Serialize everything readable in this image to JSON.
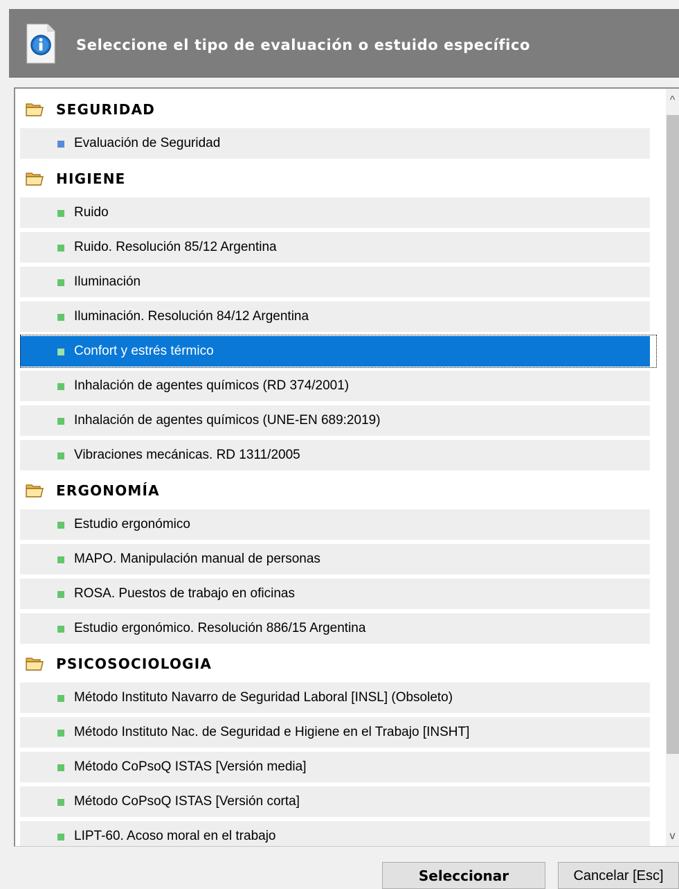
{
  "header": {
    "title": "Seleccione el tipo de evaluación o estuido específico",
    "icon": "info-icon"
  },
  "tree": [
    {
      "type": "group",
      "label": "SEGURIDAD",
      "icon": "folder-open-icon"
    },
    {
      "type": "item",
      "label": "Evaluación de Seguridad",
      "bullet": "blue"
    },
    {
      "type": "group",
      "label": "HIGIENE",
      "icon": "folder-open-icon"
    },
    {
      "type": "item",
      "label": "Ruido",
      "bullet": "green"
    },
    {
      "type": "item",
      "label": "Ruido. Resolución 85/12 Argentina",
      "bullet": "green"
    },
    {
      "type": "item",
      "label": "Iluminación",
      "bullet": "green"
    },
    {
      "type": "item",
      "label": "Iluminación. Resolución 84/12 Argentina",
      "bullet": "green"
    },
    {
      "type": "item",
      "label": "Confort y estrés térmico",
      "bullet": "green",
      "selected": true
    },
    {
      "type": "item",
      "label": "Inhalación de agentes químicos (RD 374/2001)",
      "bullet": "green"
    },
    {
      "type": "item",
      "label": "Inhalación de agentes químicos (UNE-EN 689:2019)",
      "bullet": "green"
    },
    {
      "type": "item",
      "label": "Vibraciones mecánicas. RD 1311/2005",
      "bullet": "green"
    },
    {
      "type": "group",
      "label": "ERGONOMÍA",
      "icon": "folder-open-icon"
    },
    {
      "type": "item",
      "label": "Estudio ergonómico",
      "bullet": "green"
    },
    {
      "type": "item",
      "label": "MAPO. Manipulación manual de personas",
      "bullet": "green"
    },
    {
      "type": "item",
      "label": "ROSA. Puestos de trabajo en oficinas",
      "bullet": "green"
    },
    {
      "type": "item",
      "label": "Estudio ergonómico. Resolución 886/15 Argentina",
      "bullet": "green"
    },
    {
      "type": "group",
      "label": "PSICOSOCIOLOGIA",
      "icon": "folder-open-icon"
    },
    {
      "type": "item",
      "label": "Método Instituto Navarro de Seguridad Laboral  [INSL]  (Obsoleto)",
      "bullet": "green"
    },
    {
      "type": "item",
      "label": "Método Instituto Nac. de Seguridad e Higiene en el Trabajo  [INSHT]",
      "bullet": "green"
    },
    {
      "type": "item",
      "label": "Método CoPsoQ ISTAS  [Versión media]",
      "bullet": "green"
    },
    {
      "type": "item",
      "label": "Método CoPsoQ ISTAS  [Versión corta]",
      "bullet": "green"
    },
    {
      "type": "item",
      "label": "LIPT-60. Acoso moral en el trabajo",
      "bullet": "green"
    }
  ],
  "scrollbar": {
    "up": "^",
    "down": "v"
  },
  "buttons": {
    "select_label": "Seleccionar",
    "cancel_label": "Cancelar [Esc]"
  },
  "colors": {
    "header_bg": "#7d7d7d",
    "selection": "#0a78d6",
    "item_bullet": "#63c66b",
    "seguridad_bullet": "#5b8ad6"
  }
}
